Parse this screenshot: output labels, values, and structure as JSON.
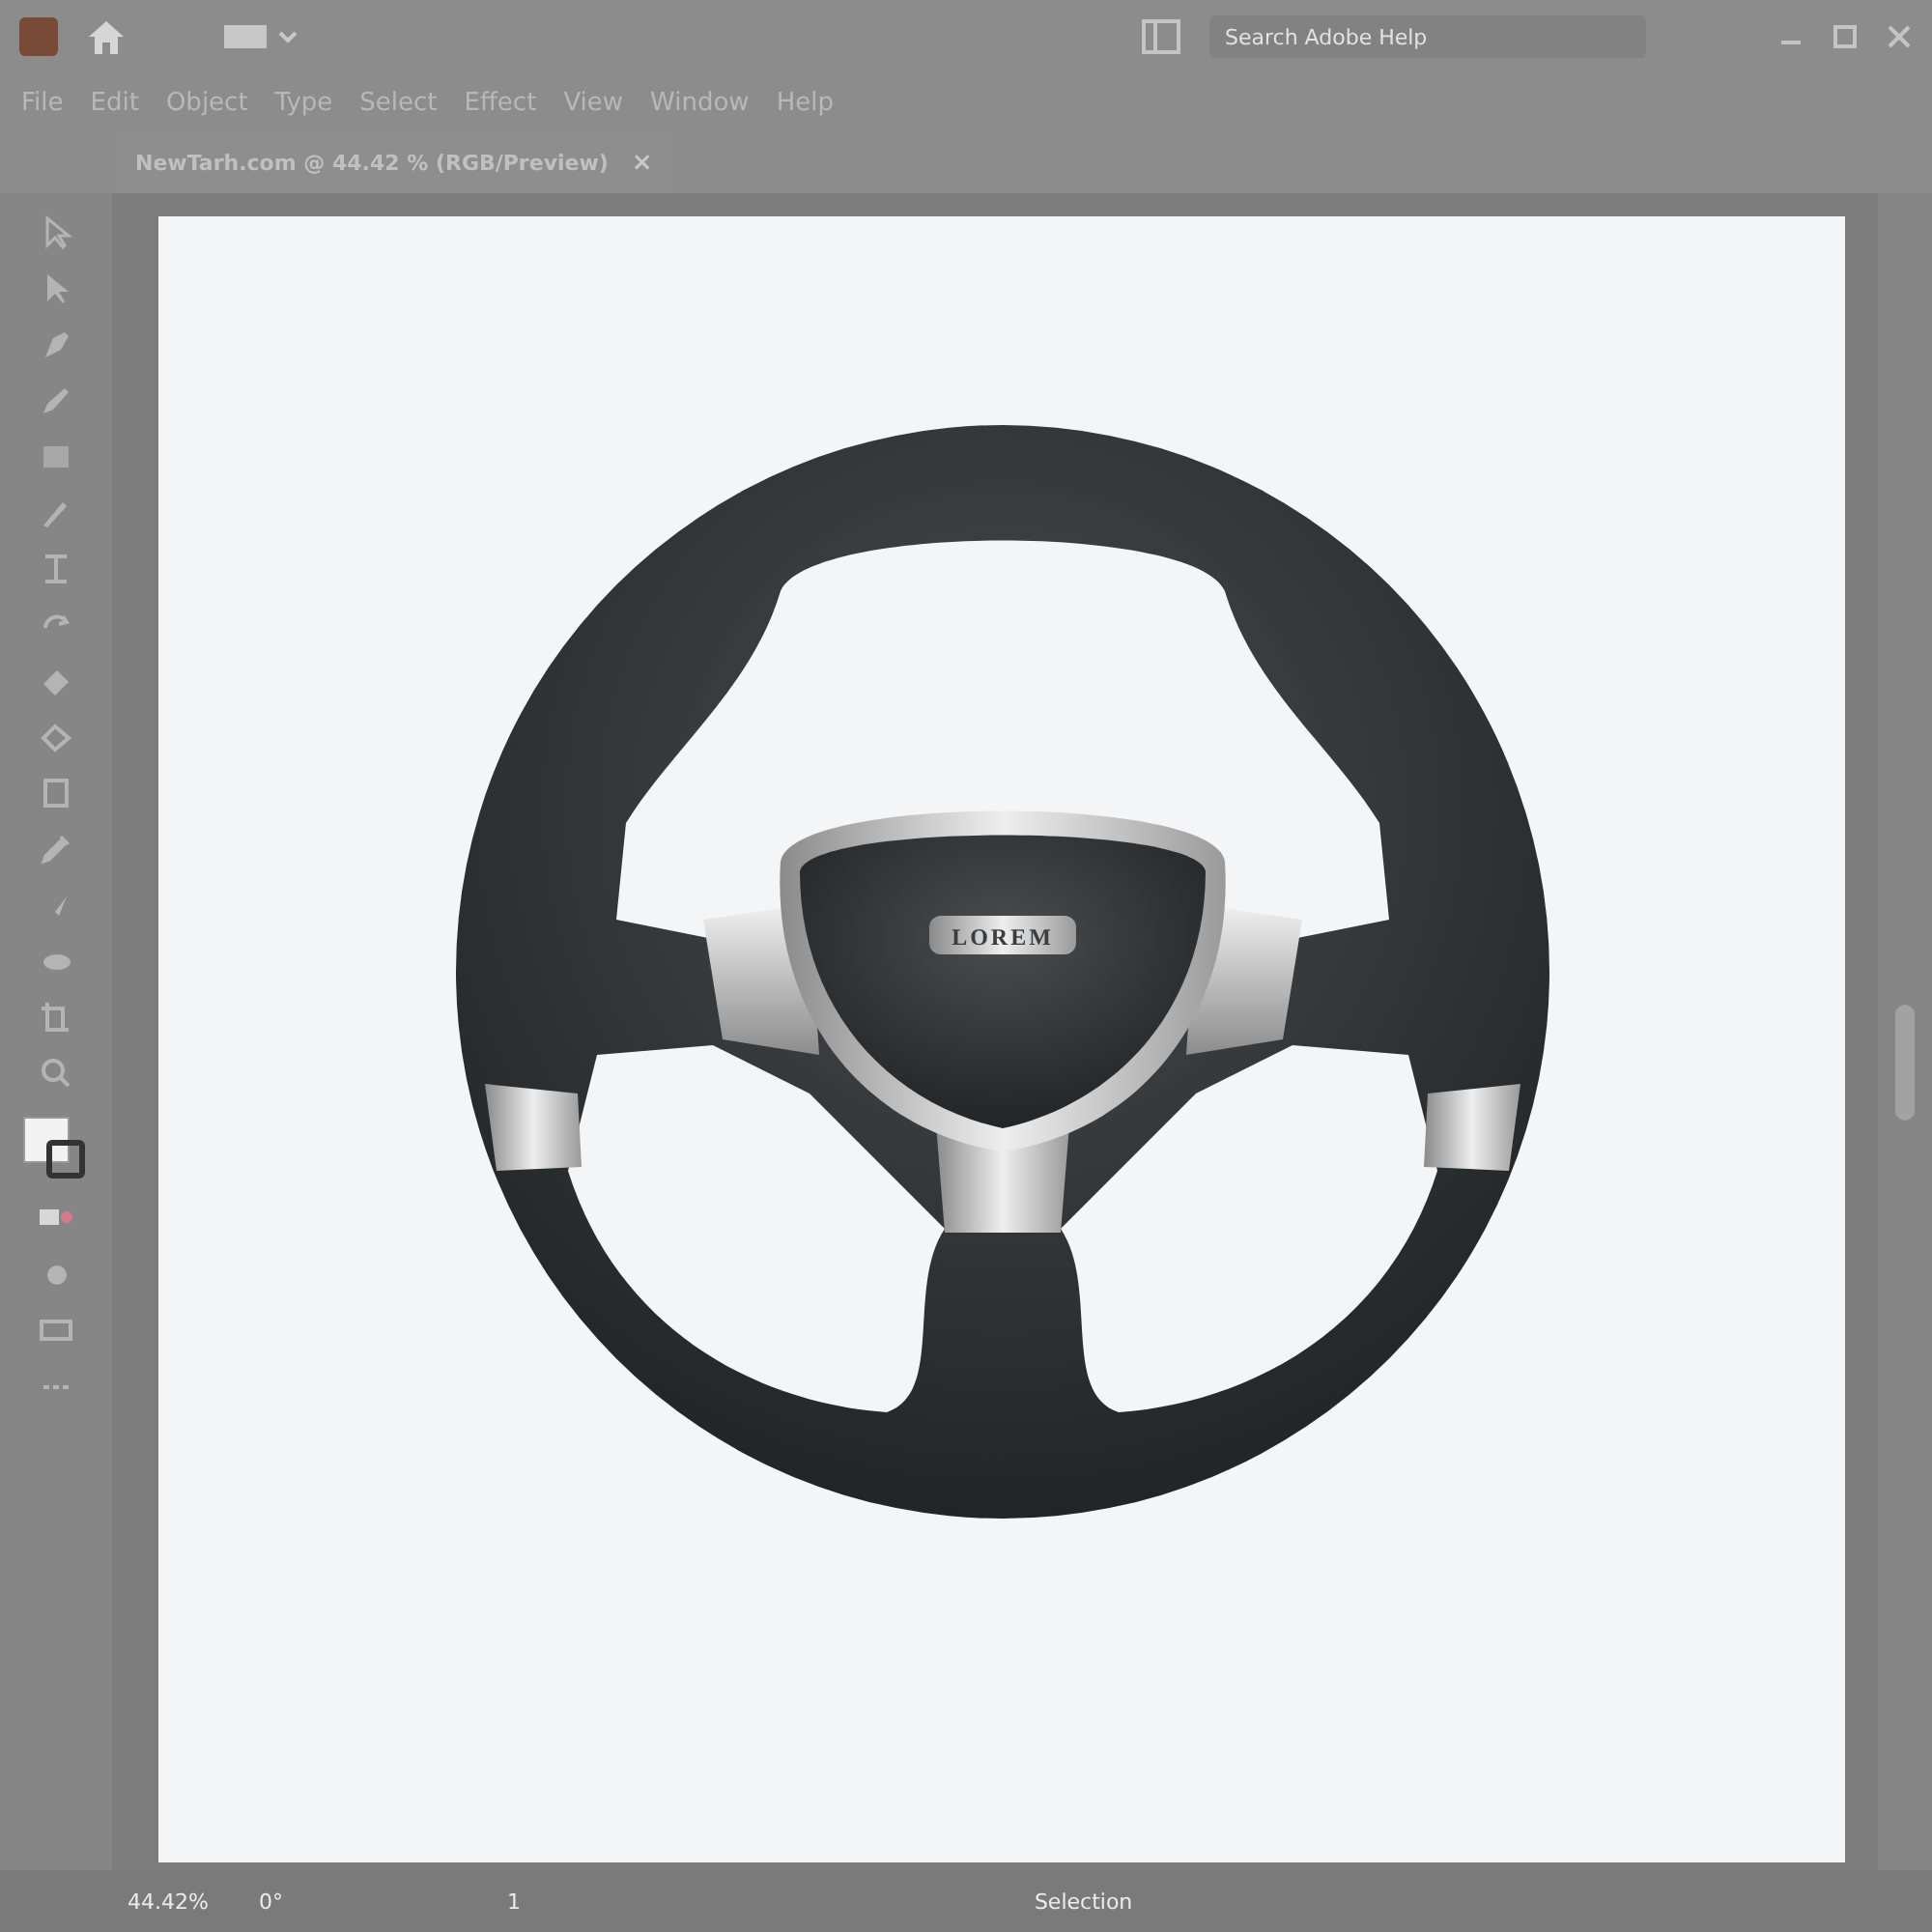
{
  "menu_bar": {
    "items": [
      "File",
      "Edit",
      "Object",
      "Type",
      "Select",
      "Effect",
      "View",
      "Window",
      "Help"
    ]
  },
  "search": {
    "placeholder": "Search Adobe Help"
  },
  "document_tab": {
    "title": "NewTarh.com @ 44.42 % (RGB/Preview)",
    "close": "×"
  },
  "artwork": {
    "emblem_label": "LOREM"
  },
  "status_bar": {
    "zoom": "44.42%",
    "rotation": "0°",
    "artboard": "1",
    "tool": "Selection"
  }
}
